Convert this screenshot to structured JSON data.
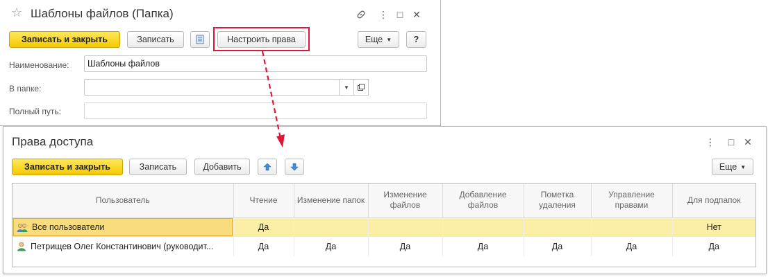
{
  "folder_window": {
    "title": "Шаблоны файлов (Папка)",
    "toolbar": {
      "save_close_label": "Записать и закрыть",
      "save_label": "Записать",
      "rights_label": "Настроить права",
      "more_label": "Еще",
      "help_label": "?"
    },
    "fields": {
      "name_label": "Наименование:",
      "name_value": "Шаблоны файлов",
      "folder_label": "В папке:",
      "folder_value": "",
      "path_label": "Полный путь:",
      "path_value": ""
    }
  },
  "rights_window": {
    "title": "Права доступа",
    "toolbar": {
      "save_close_label": "Записать и закрыть",
      "save_label": "Записать",
      "add_label": "Добавить",
      "more_label": "Еще"
    },
    "table": {
      "headers": {
        "user": "Пользователь",
        "read": "Чтение",
        "edit_folders": "Изменение папок",
        "edit_files": "Изменение файлов",
        "add_files": "Добавление файлов",
        "mark_delete": "Пометка удаления",
        "manage_rights": "Управление правами",
        "for_subfolders": "Для подпапок"
      },
      "rows": [
        {
          "user": "Все пользователи",
          "read": "Да",
          "edit_folders": "",
          "edit_files": "",
          "add_files": "",
          "mark_delete": "",
          "manage_rights": "",
          "for_subfolders": "Нет"
        },
        {
          "user": "Петрищев Олег Константинович (руководит...",
          "read": "Да",
          "edit_folders": "Да",
          "edit_files": "Да",
          "add_files": "Да",
          "mark_delete": "Да",
          "manage_rights": "Да",
          "for_subfolders": "Да"
        }
      ]
    }
  },
  "colors": {
    "primary_button": "#f6c900",
    "highlight": "#e0153a",
    "selected_row": "#fbeea5"
  }
}
